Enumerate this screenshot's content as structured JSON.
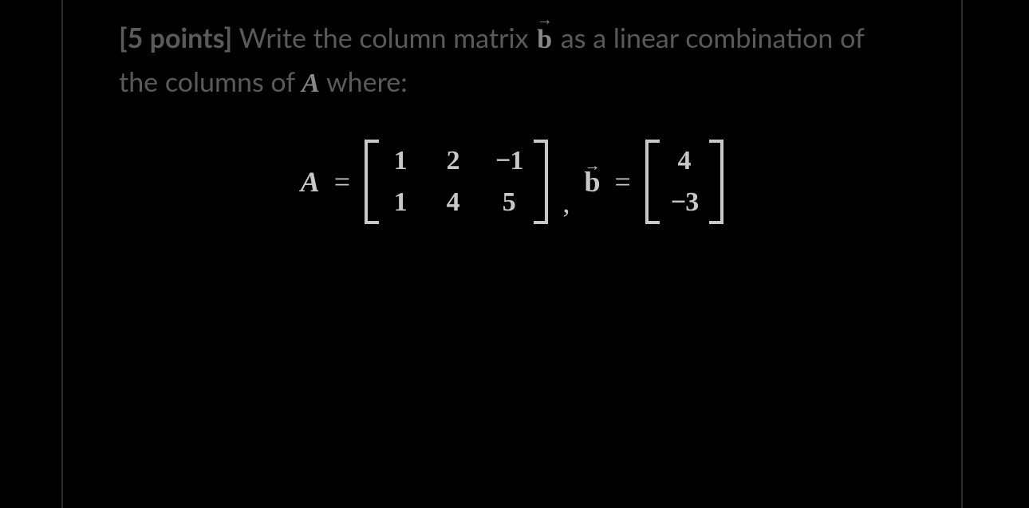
{
  "problem": {
    "points_label": "[5 points]",
    "text_before_b": " Write the column matrix ",
    "vector_b_symbol": "b",
    "vector_arrow": "→",
    "text_after_b": " as a linear combination of the columns of ",
    "matrix_A_symbol": "A",
    "text_end": " where:"
  },
  "equation": {
    "A_label": "A",
    "eq_sign": "=",
    "A": {
      "rows": 2,
      "cols": 3,
      "cells": [
        "1",
        "2",
        "−1",
        "1",
        "4",
        "5"
      ]
    },
    "comma": ",",
    "b_label": "b",
    "b_arrow": "→",
    "b": {
      "rows": 2,
      "cols": 1,
      "cells": [
        "4",
        "−3"
      ]
    }
  }
}
